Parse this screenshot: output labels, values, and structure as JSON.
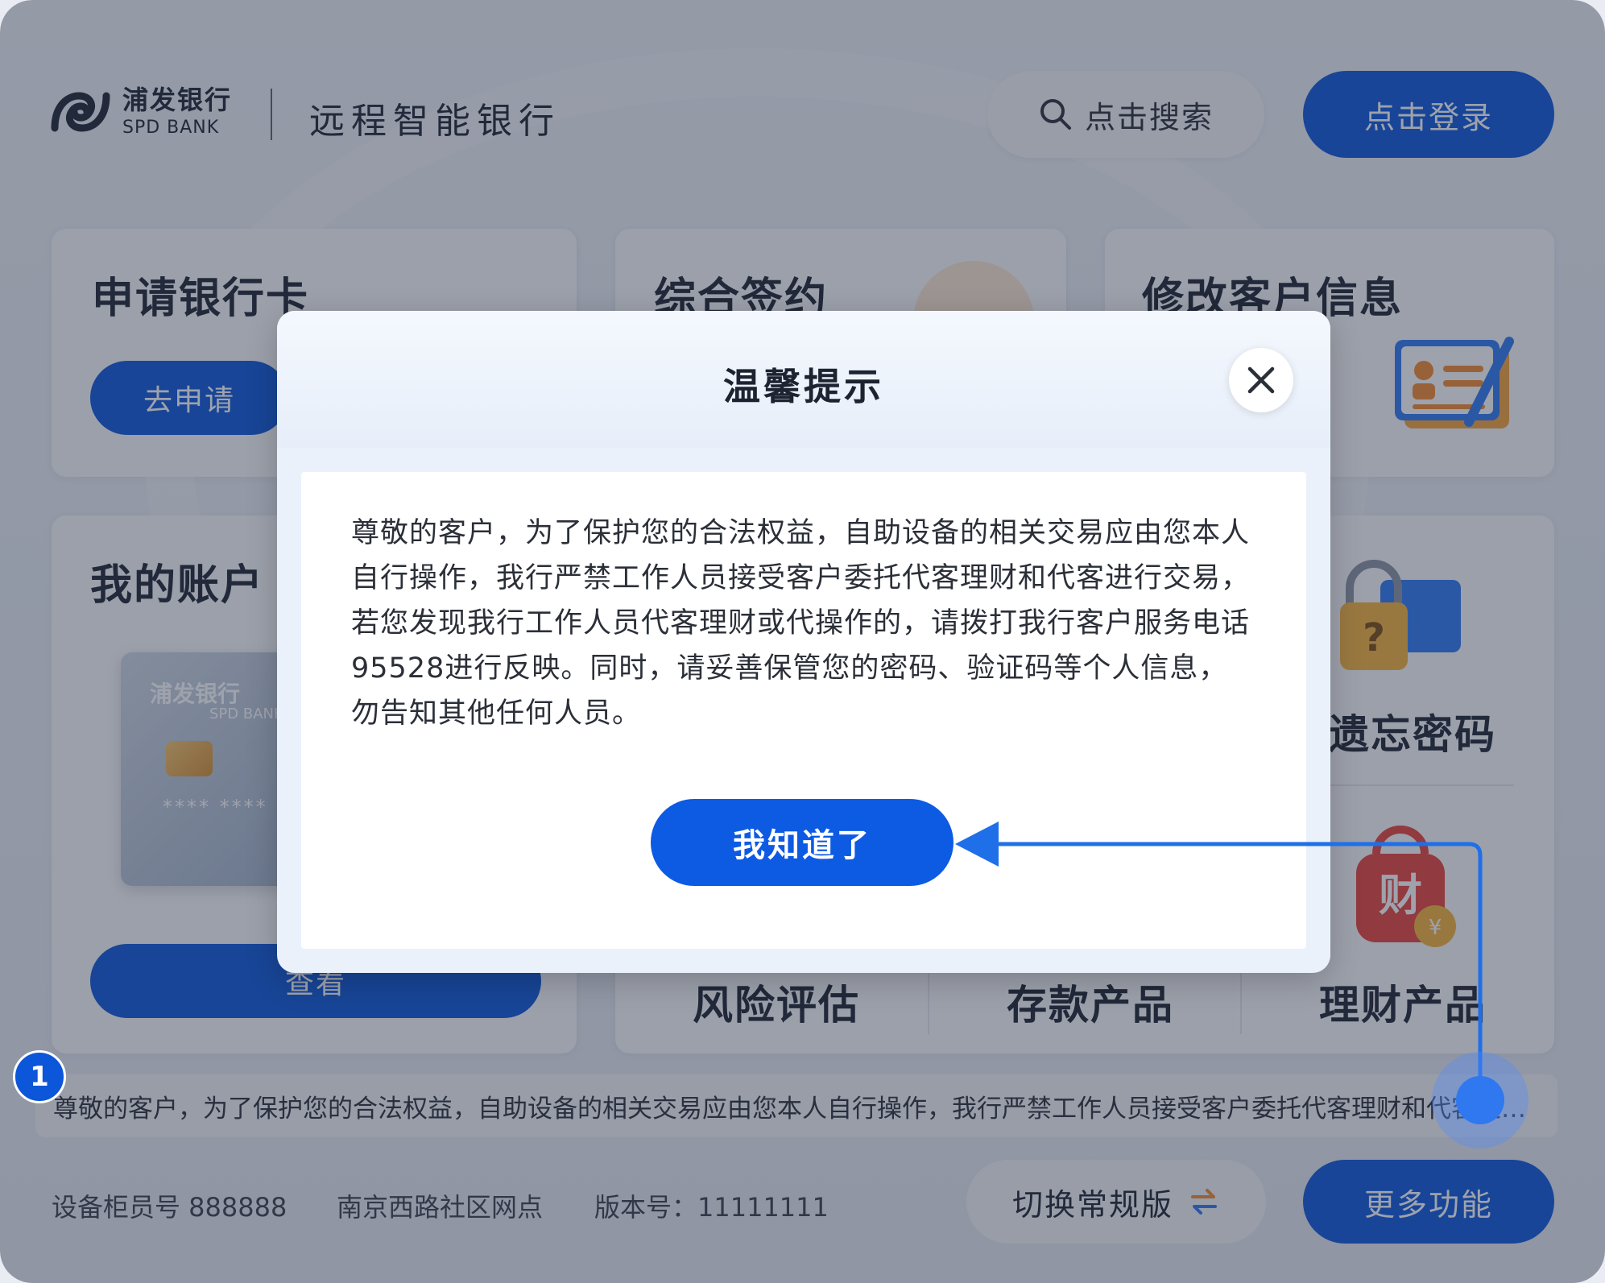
{
  "header": {
    "logo_cn": "浦发银行",
    "logo_en": "SPD BANK",
    "app_title": "远程智能银行",
    "search_label": "点击搜索",
    "login_label": "点击登录"
  },
  "cards": {
    "apply_card": {
      "title": "申请银行卡",
      "button": "去申请"
    },
    "sign": {
      "title": "综合签约"
    },
    "modify_info": {
      "title": "修改客户信息"
    },
    "my_account": {
      "title": "我的账户",
      "button": "查看",
      "bank_card": {
        "logo_cn": "浦发银行",
        "logo_en": "SPD BANK",
        "number": "**** ****"
      }
    },
    "forgot_password": {
      "title": "遗忘密码"
    },
    "tiles": [
      {
        "label": "风险评估"
      },
      {
        "label": "存款产品"
      },
      {
        "label": "理财产品"
      }
    ]
  },
  "notice": {
    "text": "尊敬的客户，为了保护您的合法权益，自助设备的相关交易应由您本人自行操作，我行严禁工作人员接受客户委托代客理财和代客进行交易…"
  },
  "footer": {
    "device_teller": "设备柜员号 888888",
    "branch": "南京西路社区网点",
    "version": "版本号：11111111",
    "switch_label": "切换常规版",
    "more_label": "更多功能"
  },
  "modal": {
    "title": "温馨提示",
    "body": "尊敬的客户，为了保护您的合法权益，自助设备的相关交易应由您本人自行操作，我行严禁工作人员接受客户委托代客理财和代客进行交易，若您发现我行工作人员代客理财或代操作的，请拨打我行客户服务电话95528进行反映。同时，请妥善保管您的密码、验证码等个人信息，勿告知其他任何人员。",
    "ok_label": "我知道了"
  },
  "annotation": {
    "step": "1"
  },
  "colors": {
    "primary": "#0b56d9",
    "accent_orange": "#f28a2e"
  }
}
